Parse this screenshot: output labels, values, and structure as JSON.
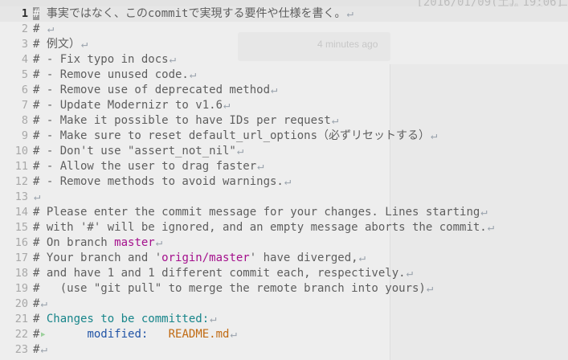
{
  "app": {
    "background_clock": "[2016/01/09(土) 19:06]",
    "time_ago": "4 minutes ago",
    "eol_glyph": "↵"
  },
  "lines": [
    {
      "n": "1",
      "t": "事実ではなく、このcommitで実現する要件や仕様を書く。",
      "hash": "#"
    },
    {
      "n": "2",
      "t": "# "
    },
    {
      "n": "3",
      "t": "# 例文）"
    },
    {
      "n": "4",
      "t": "# - Fix typo in docs"
    },
    {
      "n": "5",
      "t": "# - Remove unused code."
    },
    {
      "n": "6",
      "t": "# - Remove use of deprecated method"
    },
    {
      "n": "7",
      "t": "# - Update Modernizr to v1.6"
    },
    {
      "n": "8",
      "t": "# - Make it possible to have IDs per request"
    },
    {
      "n": "9",
      "t": "# - Make sure to reset default_url_options（必ずリセットする）"
    },
    {
      "n": "10",
      "t": "# - Don't use \"assert_not_nil\""
    },
    {
      "n": "11",
      "t": "# - Allow the user to drag faster"
    },
    {
      "n": "12",
      "t": "# - Remove methods to avoid warnings."
    },
    {
      "n": "13",
      "t": ""
    },
    {
      "n": "14",
      "t": "# Please enter the commit message for your changes. Lines starting"
    },
    {
      "n": "15",
      "t": "# with '#' will be ignored, and an empty message aborts the commit."
    },
    {
      "n": "16",
      "a": "# On branch ",
      "b": "master"
    },
    {
      "n": "17",
      "a": "# Your branch and '",
      "b": "origin/master",
      "c": "' have diverged,"
    },
    {
      "n": "18",
      "t": "# and have 1 and 1 different commit each, respectively."
    },
    {
      "n": "19",
      "t": "#   (use \"git pull\" to merge the remote branch into yours)"
    },
    {
      "n": "20",
      "t": "#"
    },
    {
      "n": "21",
      "a": "# ",
      "b": "Changes to be committed:"
    },
    {
      "n": "22",
      "hash": "#",
      "tab": "▸",
      "status": "modified:",
      "file": "README.md"
    },
    {
      "n": "23",
      "t": "#"
    }
  ]
}
